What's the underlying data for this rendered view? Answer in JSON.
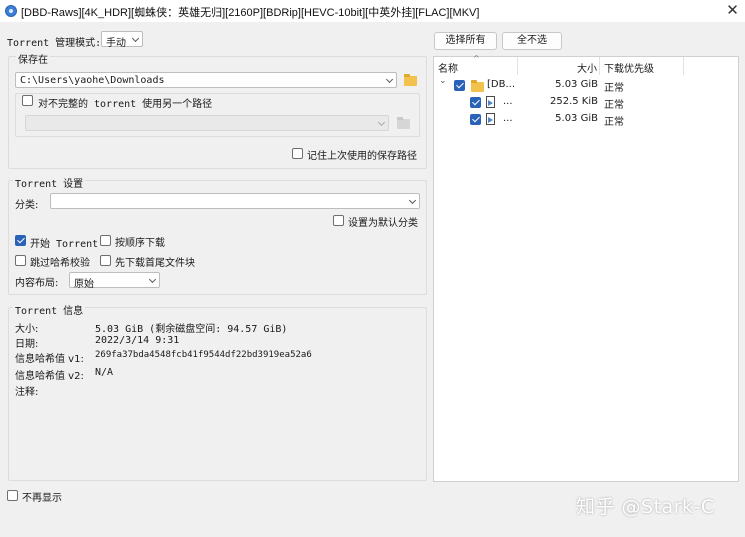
{
  "window": {
    "title": "[DBD-Raws][4K_HDR][蜘蛛侠：英雄无归][2160P][BDRip][HEVC-10bit][中英外挂][FLAC][MKV]",
    "close_glyph": "✕"
  },
  "management": {
    "label": "Torrent 管理模式:",
    "value": "手动"
  },
  "save_location": {
    "group_title": "保存在",
    "path": "C:\\Users\\yaohe\\Downloads",
    "incomplete_label": "对不完整的 torrent 使用另一个路径",
    "remember_label": "记住上次使用的保存路径"
  },
  "torrent_settings": {
    "group_title": "Torrent 设置",
    "category_label": "分类:",
    "category_value": "",
    "default_category_label": "设置为默认分类",
    "start_label": "开始 Torrent",
    "sequential_label": "按顺序下载",
    "skip_hash_label": "跳过哈希校验",
    "first_last_label": "先下载首尾文件块",
    "layout_label": "内容布局:",
    "layout_value": "原始"
  },
  "torrent_info": {
    "group_title": "Torrent 信息",
    "rows": [
      {
        "key": "大小:",
        "value": "5.03 GiB (剩余磁盘空间: 94.57 GiB)"
      },
      {
        "key": "日期:",
        "value": "2022/3/14 9:31"
      },
      {
        "key": "信息哈希值 v1:",
        "value": "269fa37bda4548fcb41f9544df22bd3919ea52a6"
      },
      {
        "key": "信息哈希值 v2:",
        "value": "N/A"
      },
      {
        "key": "注释:",
        "value": ""
      }
    ]
  },
  "dont_show_label": "不再显示",
  "buttons": {
    "select_all": "选择所有",
    "select_none": "全不选"
  },
  "file_list": {
    "headers": {
      "name": "名称",
      "size": "大小",
      "priority": "下载优先级"
    },
    "rows": [
      {
        "name": "[DB...",
        "size": "5.03 GiB",
        "priority": "正常",
        "type": "folder"
      },
      {
        "name": "...",
        "size": "252.5 KiB",
        "priority": "正常",
        "type": "file"
      },
      {
        "name": "...",
        "size": "5.03 GiB",
        "priority": "正常",
        "type": "file"
      }
    ]
  },
  "watermark": "知乎 @Stark-C",
  "colors": {
    "accent": "#2a62b9",
    "folder": "#f2c14e"
  },
  "icons": [
    "app-icon",
    "close-icon",
    "folder-icon",
    "chevron-down-icon",
    "file-icon",
    "sort-arrow-icon"
  ]
}
